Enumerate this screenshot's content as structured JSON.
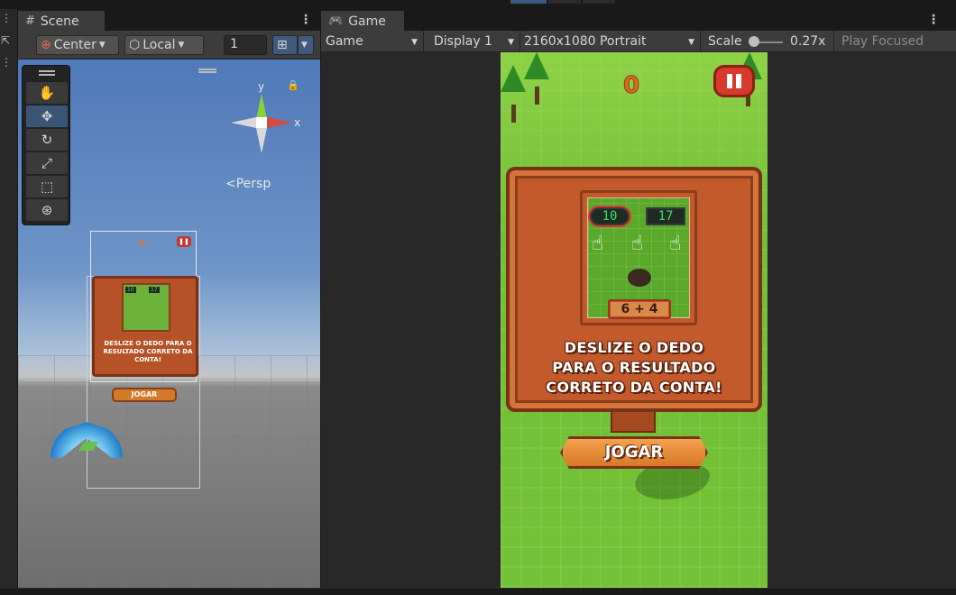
{
  "scene": {
    "tab_label": "Scene",
    "tab_icon": "hash-icon",
    "pivot_label": "Center",
    "space_label": "Local",
    "grid_value": "1",
    "persp_label": "Persp",
    "gizmo": {
      "y_label": "y",
      "x_label": "x"
    },
    "tools": [
      "hand-tool",
      "move-tool",
      "rotate-tool",
      "scale-tool",
      "rect-tool",
      "transform-tool"
    ],
    "mini_board_text": "DESLIZE O DEDO PARA O RESULTADO CORRETO DA CONTA!",
    "mini_jogar": "JOGAR",
    "mini_score": "0",
    "mini_numbers": [
      "10",
      "17"
    ]
  },
  "game": {
    "tab_label": "Game",
    "tab_icon": "gamepad-icon",
    "view_select": "Game",
    "display_select": "Display 1",
    "resolution_select": "2160x1080 Portrait",
    "scale_label": "Scale",
    "scale_value": "0.27x",
    "scale_level": 0.27,
    "play_mode": "Play Focused",
    "score": "0",
    "tutorial": {
      "left_number": "10",
      "right_number": "17",
      "equation": "6 + 4"
    },
    "board_text_lines": [
      "DESLIZE O DEDO",
      "PARA O RESULTADO",
      "CORRETO DA CONTA!"
    ],
    "play_button": "JOGAR"
  },
  "colors": {
    "editor_bg": "#282828",
    "toolbar_bg": "#3c3c3c",
    "board_wood": "#c25a2b",
    "grass": "#74c237",
    "pause_red": "#d63a2a",
    "digit_green": "#35e06a"
  }
}
